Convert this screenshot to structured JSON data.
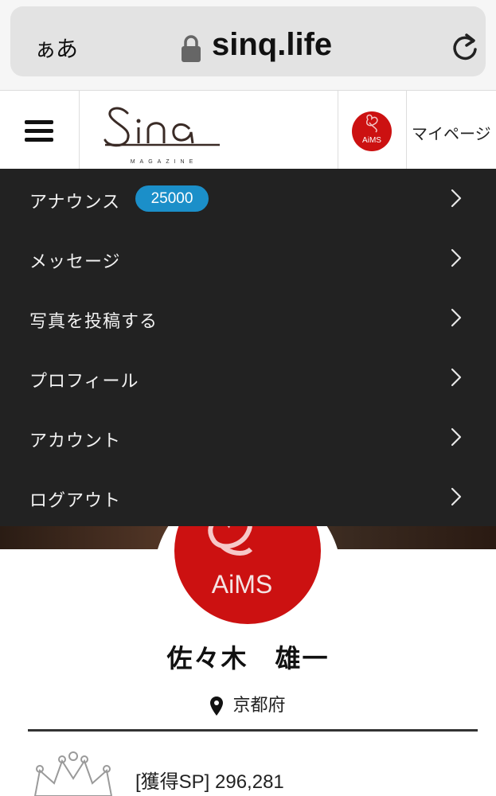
{
  "browser": {
    "text_size_label": "ぁあ",
    "url": "sinq.life",
    "lock_icon": "lock-icon",
    "reload_icon": "reload-icon"
  },
  "header": {
    "logo_text": "Sinq",
    "logo_sub": "MAGAZINE",
    "avatar_text": "AiMS",
    "mypage_label": "マイページ"
  },
  "menu": {
    "items": [
      {
        "label": "アナウンス",
        "badge": "25000"
      },
      {
        "label": "メッセージ"
      },
      {
        "label": "写真を投稿する"
      },
      {
        "label": "プロフィール"
      },
      {
        "label": "アカウント"
      },
      {
        "label": "ログアウト"
      }
    ]
  },
  "profile": {
    "avatar_text": "AiMS",
    "name": "佐々木　雄一",
    "location": "京都府",
    "sp": "[獲得SP] 296,281"
  },
  "colors": {
    "menu_bg": "#222222",
    "badge": "#1b8fc9",
    "brand_red": "#cc1111"
  }
}
